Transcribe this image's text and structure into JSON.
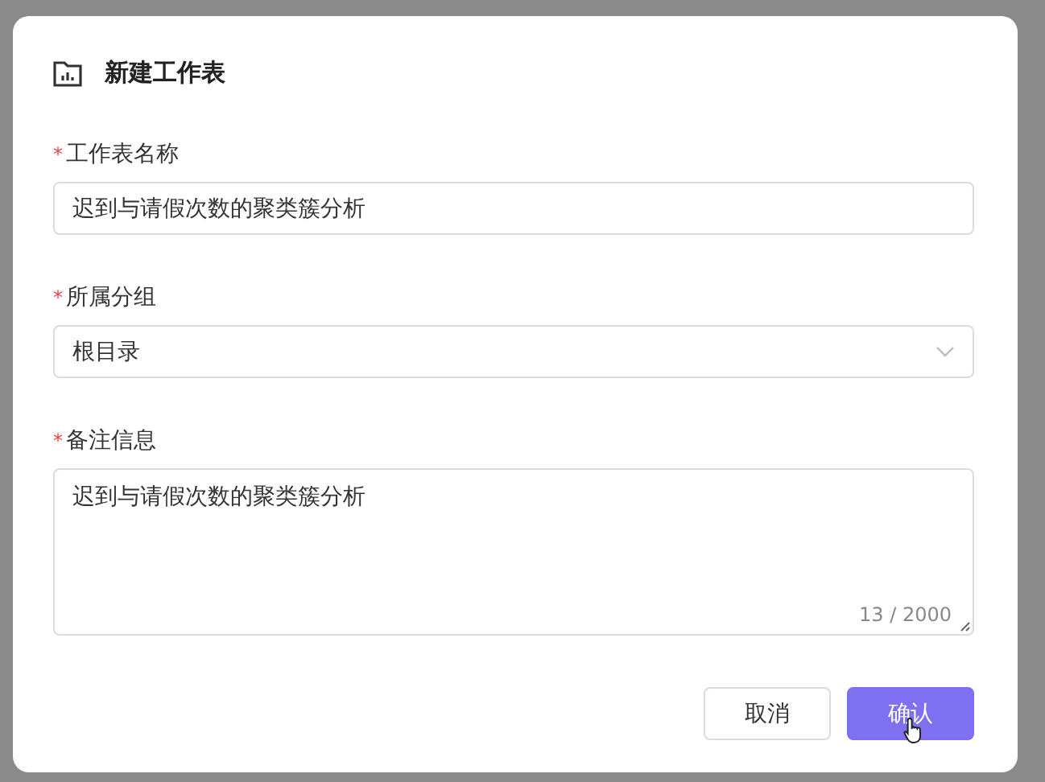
{
  "dialog": {
    "title": "新建工作表",
    "fields": [
      {
        "kind": "text",
        "mark": "*",
        "label": "工作表名称",
        "value": "迟到与请假次数的聚类簇分析"
      },
      {
        "kind": "select",
        "mark": "*",
        "label": "所属分组",
        "value": "根目录"
      },
      {
        "kind": "textarea",
        "mark": "*",
        "label": "备注信息",
        "value": "迟到与请假次数的聚类簇分析",
        "counter": "13 / 2000"
      }
    ],
    "buttons": [
      {
        "kind": "secondary",
        "label": "取消"
      },
      {
        "kind": "primary",
        "label": "确认",
        "hovered": true
      }
    ]
  }
}
